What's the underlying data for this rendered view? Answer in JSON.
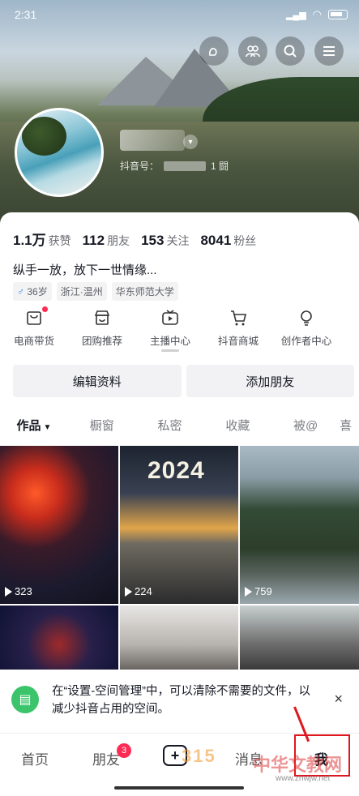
{
  "status_bar": {
    "time": "2:31",
    "battery": "99"
  },
  "profile": {
    "douyin_id_label": "抖音号：",
    "douyin_id_suffix": "1 闘",
    "stats": [
      {
        "value": "1.1万",
        "label": "获赞"
      },
      {
        "value": "112",
        "label": "朋友"
      },
      {
        "value": "153",
        "label": "关注"
      },
      {
        "value": "8041",
        "label": "粉丝"
      }
    ],
    "bio": "纵手一放，放下一世情缘...",
    "tags": {
      "age": "36岁",
      "location": "浙江·温州",
      "school": "华东师范大学"
    }
  },
  "shortcuts": [
    {
      "label": "电商带货"
    },
    {
      "label": "团购推荐"
    },
    {
      "label": "主播中心"
    },
    {
      "label": "抖音商城"
    },
    {
      "label": "创作者中心"
    }
  ],
  "actions": {
    "edit": "编辑资料",
    "add_friend": "添加朋友"
  },
  "tabs": [
    "作品",
    "橱窗",
    "私密",
    "收藏",
    "被@",
    "喜"
  ],
  "videos": [
    {
      "plays": "323"
    },
    {
      "plays": "224",
      "overlay": "2024"
    },
    {
      "plays": "759"
    }
  ],
  "toast": {
    "message": "在“设置-空间管理”中，可以清除不需要的文件，以减少抖音占用的空间。",
    "close": "×"
  },
  "nav": {
    "home": "首页",
    "friends": "朋友",
    "friends_badge": "3",
    "plus": "+",
    "messages": "消息",
    "me": "我"
  },
  "watermarks": {
    "w1": "315",
    "w2": "中华文教网",
    "w3": "www.zhwjw.net"
  },
  "colors": {
    "accent": "#fe2c55",
    "toast_icon": "#3cc46b",
    "highlight": "#e0161e"
  }
}
